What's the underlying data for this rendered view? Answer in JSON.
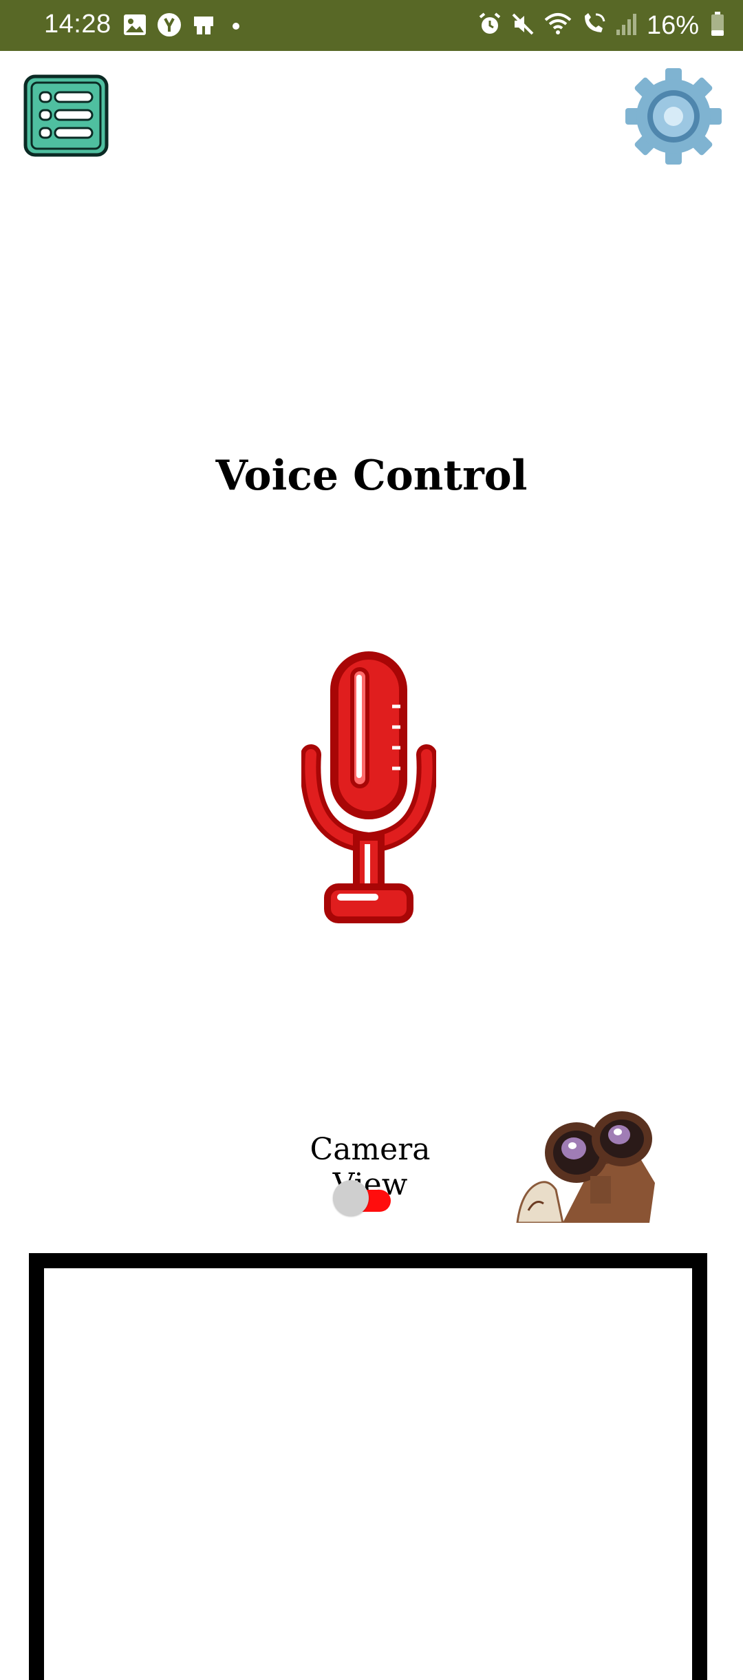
{
  "status_bar": {
    "time": "14:28",
    "battery_percent": "16%",
    "background_color": "#586826",
    "left_icons": [
      "gallery-icon",
      "yandex-icon",
      "store-icon",
      "notification-dot"
    ],
    "right_icons": [
      "alarm-icon",
      "mute-icon",
      "wifi-icon",
      "wifi-calling-icon",
      "signal-icon",
      "battery-icon"
    ]
  },
  "header": {
    "menu_icon": "list-menu-icon",
    "settings_icon": "gear-icon"
  },
  "main": {
    "title": "Voice Control",
    "mic_icon": "microphone-icon",
    "mic_color": "#d11111"
  },
  "camera": {
    "label": "Camera View",
    "toggle_on": false,
    "toggle_track_color": "#ff0d0d",
    "image": "robot-binoculars-image"
  }
}
